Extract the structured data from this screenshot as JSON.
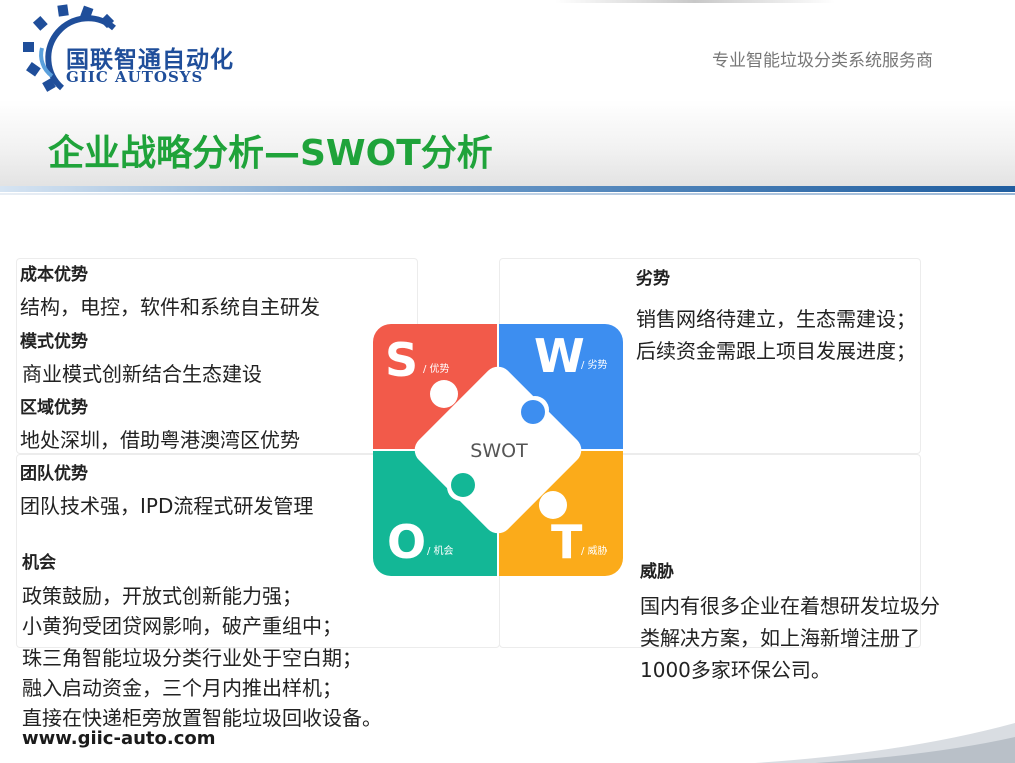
{
  "header": {
    "logo_cn": "国联智通自动化",
    "logo_en": "GIIC AUTOSYS",
    "tagline": "专业智能垃圾分类系统服务商",
    "title": "企业战略分析—SWOT分析"
  },
  "strengths": [
    {
      "heading": "成本优势",
      "text": "结构，电控，软件和系统自主研发"
    },
    {
      "heading": "模式优势",
      "text": "商业模式创新结合生态建设"
    },
    {
      "heading": "区域优势",
      "text": "地处深圳，借助粤港澳湾区优势"
    },
    {
      "heading": "团队优势",
      "text": "团队技术强，IPD流程式研发管理"
    }
  ],
  "weaknesses": {
    "heading": "劣势",
    "lines": [
      "销售网络待建立，生态需建设；",
      "后续资金需跟上项目发展进度；"
    ]
  },
  "opportunities": {
    "heading": "机会",
    "lines": [
      "政策鼓励，开放式创新能力强；",
      "小黄狗受团贷网影响，破产重组中；",
      "珠三角智能垃圾分类行业处于空白期；",
      "融入启动资金，三个月内推出样机；",
      "直接在快递柜旁放置智能垃圾回收设备。"
    ]
  },
  "threats": {
    "heading": "威胁",
    "lines": [
      "国内有很多企业在着想研发垃圾分",
      "类解决方案，如上海新增注册了",
      "1000多家环保公司。"
    ]
  },
  "swot_graphic": {
    "center": "SWOT",
    "s": {
      "letter": "S",
      "label": "/ 优势",
      "color": "#f25a4a"
    },
    "w": {
      "letter": "W",
      "label": "/ 劣势",
      "color": "#3d8ef0"
    },
    "o": {
      "letter": "O",
      "label": "/ 机会",
      "color": "#13b796"
    },
    "t": {
      "letter": "T",
      "label": "/ 威胁",
      "color": "#fbab1a"
    }
  },
  "colors": {
    "title_green": "#1fa33a",
    "brand_blue": "#1f4e9a",
    "header_rule": "#1f5d9f"
  },
  "footer": {
    "url": "www.giic-auto.com"
  }
}
